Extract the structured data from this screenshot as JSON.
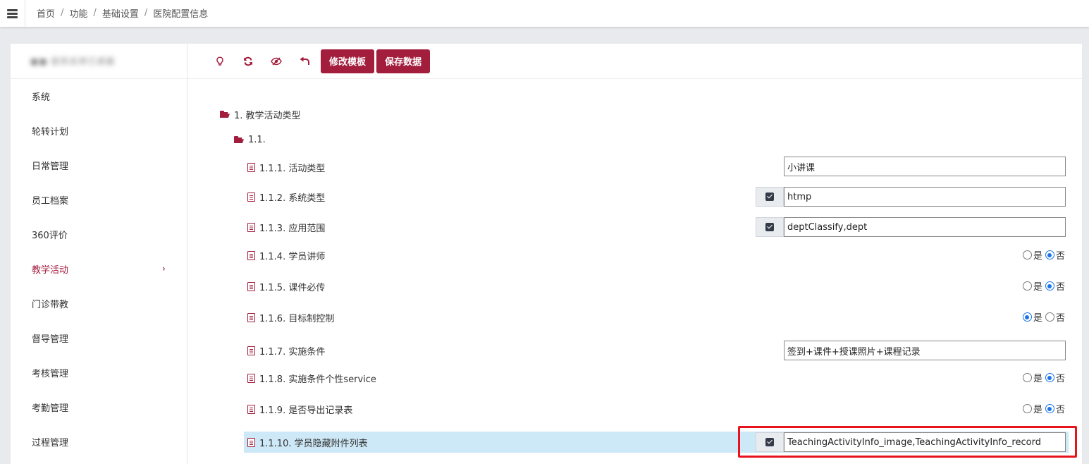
{
  "breadcrumb": {
    "items": [
      "首页",
      "功能",
      "基础设置",
      "医院配置信息"
    ],
    "separator": "/"
  },
  "sidebar": {
    "header_text": "■■ 医院名称已遮蔽",
    "items": [
      {
        "label": "系统"
      },
      {
        "label": "轮转计划"
      },
      {
        "label": "日常管理"
      },
      {
        "label": "员工档案"
      },
      {
        "label": "360评价"
      },
      {
        "label": "教学活动",
        "active": true
      },
      {
        "label": "门诊带教"
      },
      {
        "label": "督导管理"
      },
      {
        "label": "考核管理"
      },
      {
        "label": "考勤管理"
      },
      {
        "label": "过程管理"
      }
    ],
    "active_chevron": "›"
  },
  "toolbar": {
    "icons": [
      "lightbulb-icon",
      "refresh-icon",
      "eye-slash-icon",
      "undo-icon"
    ],
    "edit_template_label": "修改模板",
    "save_data_label": "保存数据"
  },
  "tree": {
    "root": "1. 教学活动类型",
    "group": "1.1.",
    "rows": [
      {
        "label": "1.1.1. 活动类型",
        "kind": "text",
        "value": "小讲课"
      },
      {
        "label": "1.1.2. 系统类型",
        "kind": "check-text",
        "value": "htmp"
      },
      {
        "label": "1.1.3. 应用范围",
        "kind": "check-text",
        "value": "deptClassify,dept"
      },
      {
        "label": "1.1.4. 学员讲师",
        "kind": "radio",
        "selected": "否"
      },
      {
        "label": "1.1.5. 课件必传",
        "kind": "radio",
        "selected": "否"
      },
      {
        "label": "1.1.6. 目标制控制",
        "kind": "radio",
        "selected": "是"
      },
      {
        "label": "1.1.7. 实施条件",
        "kind": "text",
        "value": "签到+课件+授课照片+课程记录"
      },
      {
        "label": "1.1.8. 实施条件个性service",
        "kind": "radio",
        "selected": "否"
      },
      {
        "label": "1.1.9. 是否导出记录表",
        "kind": "radio",
        "selected": "否"
      },
      {
        "label": "1.1.10. 学员隐藏附件列表",
        "kind": "check-text",
        "value": "TeachingActivityInfo_image,TeachingActivityInfo_record",
        "highlighted": true
      }
    ],
    "radio_yes": "是",
    "radio_no": "否"
  },
  "colors": {
    "accent": "#a31d3d",
    "highlight": "#cde8f6",
    "annotation": "#e8141d"
  }
}
